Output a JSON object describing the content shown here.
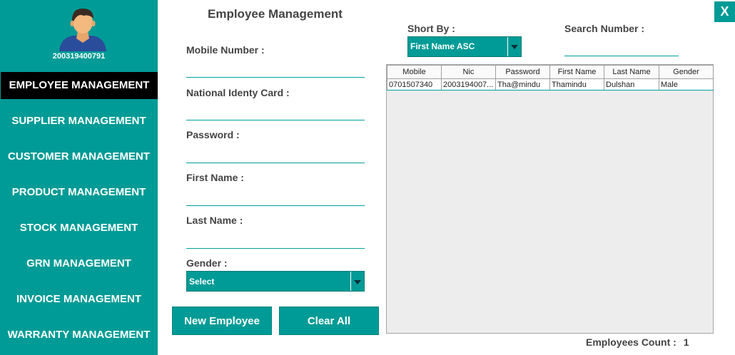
{
  "user": {
    "id": "200319400791"
  },
  "close_label": "X",
  "sidebar": {
    "items": [
      {
        "label": "EMPLOYEE MANAGEMENT"
      },
      {
        "label": "SUPPLIER MANAGEMENT"
      },
      {
        "label": "CUSTOMER MANAGEMENT"
      },
      {
        "label": "PRODUCT MANAGEMENT"
      },
      {
        "label": "STOCK MANAGEMENT"
      },
      {
        "label": "GRN MANAGEMENT"
      },
      {
        "label": "INVOICE MANAGEMENT"
      },
      {
        "label": "WARRANTY MANAGEMENT"
      }
    ]
  },
  "form": {
    "title": "Employee Management",
    "mobile_label": "Mobile Number :",
    "mobile_value": "",
    "nic_label": "National Identy Card :",
    "nic_value": "",
    "password_label": "Password :",
    "password_value": "",
    "first_name_label": "First Name :",
    "first_name_value": "",
    "last_name_label": "Last Name :",
    "last_name_value": "",
    "gender_label": "Gender :",
    "gender_value": "Select",
    "new_button": "New Employee",
    "clear_button": "Clear All"
  },
  "filters": {
    "sort_label": "Short By  :",
    "sort_value": "First Name ASC",
    "search_label": "Search Number :",
    "search_value": ""
  },
  "table": {
    "columns": [
      "Mobile",
      "Nic",
      "Password",
      "First Name",
      "Last Name",
      "Gender"
    ],
    "rows": [
      [
        "0701507340",
        "2003194007...",
        "Tha@mindu",
        "Thamindu",
        "Dulshan",
        "Male"
      ]
    ]
  },
  "footer": {
    "count_label": "Employees Count :",
    "count_value": "1"
  },
  "colors": {
    "accent": "#009b96",
    "active_nav": "#000000",
    "label_text": "#444444"
  }
}
